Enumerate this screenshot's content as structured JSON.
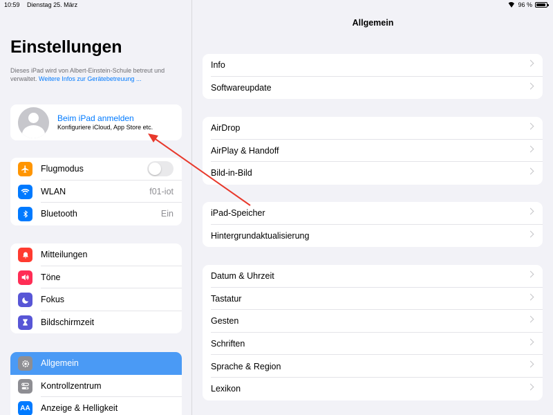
{
  "status": {
    "time": "10:59",
    "date": "Dienstag 25. März",
    "battery": "96 %",
    "battery_level": 0.96
  },
  "sidebar": {
    "title": "Einstellungen",
    "managed_text": "Dieses iPad wird von Albert-Einstein-Schule betreut und verwaltet.",
    "managed_link": "Weitere Infos zur Gerätebetreuung ...",
    "profile": {
      "title": "Beim iPad anmelden",
      "subtitle": "Konfiguriere iCloud, App Store etc."
    },
    "group1": [
      {
        "label": "Flugmodus",
        "icon": "airplane-icon",
        "color": "#ff9500",
        "toggle": false
      },
      {
        "label": "WLAN",
        "icon": "wifi-icon",
        "color": "#007aff",
        "value": "f01-iot"
      },
      {
        "label": "Bluetooth",
        "icon": "bluetooth-icon",
        "color": "#007aff",
        "value": "Ein"
      }
    ],
    "group2": [
      {
        "label": "Mitteilungen",
        "icon": "notifications-icon",
        "color": "#ff3b30"
      },
      {
        "label": "Töne",
        "icon": "sounds-icon",
        "color": "#ff2d55"
      },
      {
        "label": "Fokus",
        "icon": "focus-moon-icon",
        "color": "#5856d6"
      },
      {
        "label": "Bildschirmzeit",
        "icon": "hourglass-icon",
        "color": "#5856d6"
      }
    ],
    "group3": [
      {
        "label": "Allgemein",
        "icon": "gear-icon",
        "color": "#8e8e93",
        "selected": true
      },
      {
        "label": "Kontrollzentrum",
        "icon": "control-center-icon",
        "color": "#8e8e93"
      },
      {
        "label": "Anzeige & Helligkeit",
        "icon": "display-icon",
        "color": "#007aff",
        "glyph": "AA"
      }
    ]
  },
  "main": {
    "title": "Allgemein",
    "groups": [
      [
        "Info",
        "Softwareupdate"
      ],
      [
        "AirDrop",
        "AirPlay & Handoff",
        "Bild-in-Bild"
      ],
      [
        "iPad-Speicher",
        "Hintergrundaktualisierung"
      ],
      [
        "Datum & Uhrzeit",
        "Tastatur",
        "Gesten",
        "Schriften",
        "Sprache & Region",
        "Lexikon"
      ]
    ]
  },
  "annotation": {
    "arrow_color": "#e8392c"
  }
}
